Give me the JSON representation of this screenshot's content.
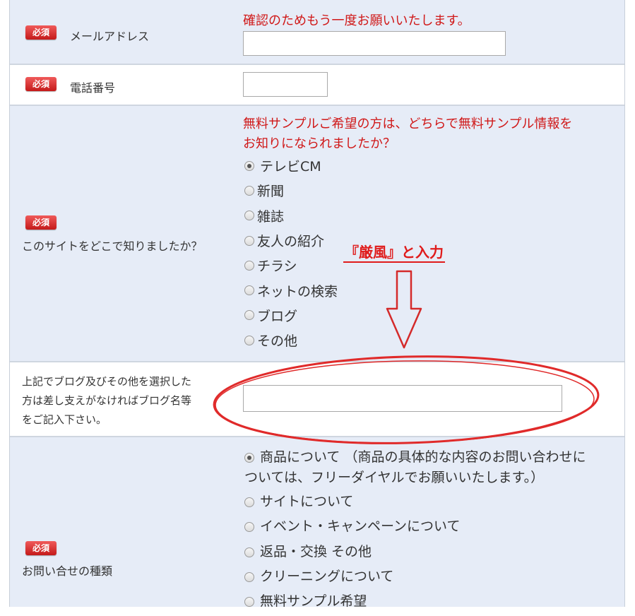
{
  "required_label": "必須",
  "email": {
    "label": "メールアドレス",
    "note": "確認のためもう一度お願いいたします。",
    "value": ""
  },
  "phone": {
    "label": "電話番号",
    "value": ""
  },
  "source": {
    "label": "このサイトをどこで知りましたか？",
    "note_line1": "無料サンプルご希望の方は、どちらで無料サンプル情報を",
    "note_line2": "お知りになられましたか？",
    "options": [
      "テレビCM",
      "新聞",
      "雑誌",
      "友人の紹介",
      "チラシ",
      "ネットの検索",
      "ブログ",
      "その他"
    ],
    "selected": "テレビCM"
  },
  "blog": {
    "label_line1": "上記でブログ及びその他を選択した",
    "label_line2": "方は差し支えがなければブログ名等",
    "label_line3": "をご記入下さい。",
    "value": ""
  },
  "annotation": {
    "text": "『厳風』と入力",
    "color": "#e01b1b"
  },
  "inquiry": {
    "label": "お問い合せの種類",
    "option1_line1": "商品について （商品の具体的な内容のお問い合わせに",
    "option1_line2": "ついては、フリーダイヤルでお願いいたします。）",
    "options": [
      "サイトについて",
      "イベント・キャンペーンについて",
      "返品・交換 その他",
      "クリーニングについて",
      "無料サンプル希望"
    ],
    "selected": "商品について"
  },
  "colors": {
    "row_alt_bg": "#e6ecf7",
    "required_badge": "#d02020",
    "note_text": "#d01818"
  }
}
